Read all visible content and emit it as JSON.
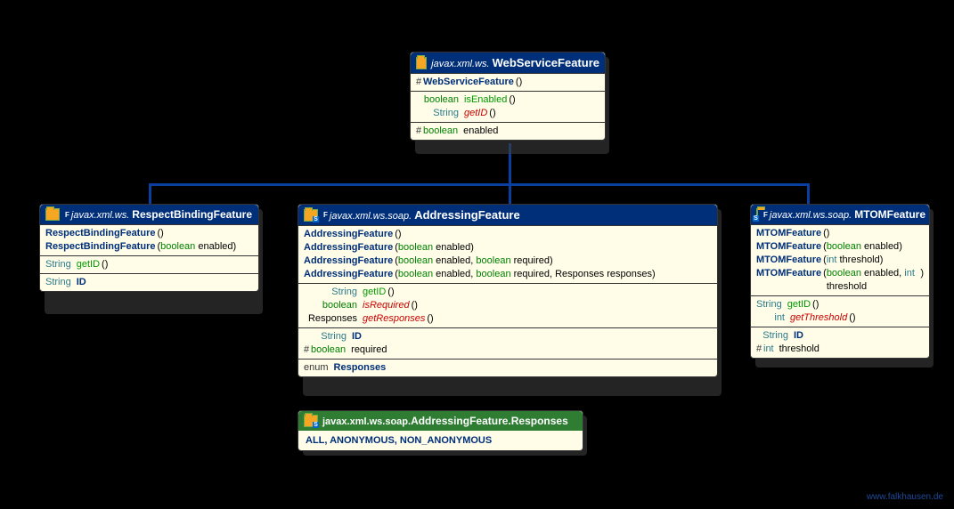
{
  "parent": {
    "package": "javax.xml.ws.",
    "name": "WebServiceFeature",
    "constructors": [
      {
        "name": "WebServiceFeature",
        "params": "()"
      }
    ],
    "methods": [
      {
        "ret": "boolean",
        "retClass": "type-b",
        "name": "isEnabled",
        "params": "()",
        "style": "norm"
      },
      {
        "ret": "String",
        "retClass": "type-str",
        "name": "getID",
        "params": "()",
        "style": "abstract"
      }
    ],
    "fields": [
      {
        "hash": "#",
        "type": "boolean",
        "typeClass": "type-b",
        "name": "enabled"
      }
    ]
  },
  "respect": {
    "package": "javax.xml.ws.",
    "name": "RespectBindingFeature",
    "constructors": [
      {
        "name": "RespectBindingFeature",
        "params": "()"
      },
      {
        "name": "RespectBindingFeature",
        "params": [
          {
            "t": "boolean",
            "c": "type-b"
          },
          {
            "t": " enabled",
            "c": ""
          }
        ]
      }
    ],
    "methods": [
      {
        "ret": "String",
        "retClass": "type-str",
        "name": "getID",
        "params": "()",
        "style": "norm"
      }
    ],
    "fields": [
      {
        "type": "String",
        "typeClass": "type-str",
        "name": "ID"
      }
    ]
  },
  "addressing": {
    "package": "javax.xml.ws.soap.",
    "name": "AddressingFeature",
    "constructors": [
      {
        "name": "AddressingFeature",
        "params": "()"
      },
      {
        "name": "AddressingFeature",
        "params": [
          {
            "t": "boolean",
            "c": "type-b"
          },
          {
            "t": " enabled",
            "c": ""
          }
        ]
      },
      {
        "name": "AddressingFeature",
        "params": [
          {
            "t": "boolean",
            "c": "type-b"
          },
          {
            "t": " enabled, ",
            "c": ""
          },
          {
            "t": "boolean",
            "c": "type-b"
          },
          {
            "t": " required",
            "c": ""
          }
        ]
      },
      {
        "name": "AddressingFeature",
        "params": [
          {
            "t": "boolean",
            "c": "type-b"
          },
          {
            "t": " enabled, ",
            "c": ""
          },
          {
            "t": "boolean",
            "c": "type-b"
          },
          {
            "t": " required, ",
            "c": ""
          },
          {
            "t": "Responses",
            "c": ""
          },
          {
            "t": " responses",
            "c": ""
          }
        ]
      }
    ],
    "methods": [
      {
        "ret": "String",
        "retClass": "type-str",
        "name": "getID",
        "params": "()",
        "style": "norm"
      },
      {
        "ret": "boolean",
        "retClass": "type-b",
        "name": "isRequired",
        "params": "()",
        "style": "abstract"
      },
      {
        "ret": "Responses",
        "retClass": "",
        "name": "getResponses",
        "params": "()",
        "style": "abstract"
      }
    ],
    "fields": [
      {
        "hash": "",
        "type": "String",
        "typeClass": "type-str",
        "name": "ID"
      },
      {
        "hash": "#",
        "type": "boolean",
        "typeClass": "type-b",
        "name": "required"
      }
    ],
    "inner": [
      {
        "type": "enum",
        "name": "Responses"
      }
    ]
  },
  "mtom": {
    "package": "javax.xml.ws.soap.",
    "name": "MTOMFeature",
    "constructors": [
      {
        "name": "MTOMFeature",
        "params": "()"
      },
      {
        "name": "MTOMFeature",
        "params": [
          {
            "t": "boolean",
            "c": "type-b"
          },
          {
            "t": " enabled",
            "c": ""
          }
        ]
      },
      {
        "name": "MTOMFeature",
        "params": [
          {
            "t": "int",
            "c": "type-int"
          },
          {
            "t": " threshold",
            "c": ""
          }
        ]
      },
      {
        "name": "MTOMFeature",
        "params": [
          {
            "t": "boolean",
            "c": "type-b"
          },
          {
            "t": " enabled, ",
            "c": ""
          },
          {
            "t": "int",
            "c": "type-int"
          },
          {
            "t": " threshold",
            "c": ""
          }
        ]
      }
    ],
    "methods": [
      {
        "ret": "String",
        "retClass": "type-str",
        "name": "getID",
        "params": "()",
        "style": "norm"
      },
      {
        "ret": "int",
        "retClass": "type-int",
        "name": "getThreshold",
        "params": "()",
        "style": "abstract"
      }
    ],
    "fields": [
      {
        "hash": "",
        "type": "String",
        "typeClass": "type-str",
        "name": "ID"
      },
      {
        "hash": "#",
        "type": "int",
        "typeClass": "type-int",
        "name": "threshold"
      }
    ]
  },
  "enum": {
    "package": "javax.xml.ws.soap.",
    "name": "AddressingFeature.Responses",
    "values": "ALL, ANONYMOUS, NON_ANONYMOUS"
  },
  "footer": "www.falkhausen.de"
}
